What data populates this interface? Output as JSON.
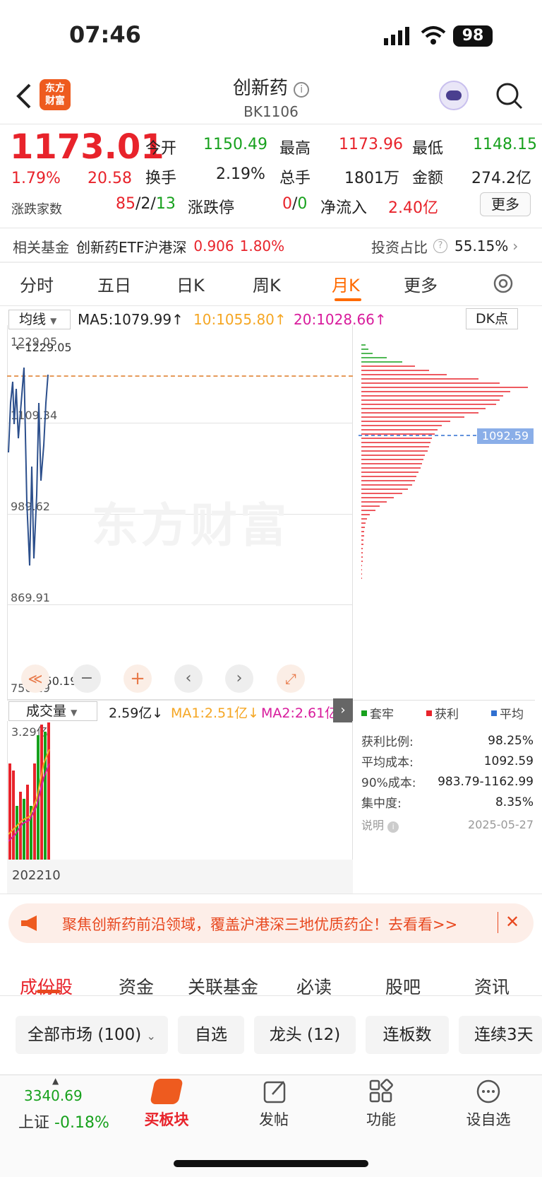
{
  "status": {
    "time": "07:46",
    "battery": "98"
  },
  "header": {
    "title": "创新药",
    "code": "BK1106",
    "logo": "东方财富"
  },
  "quote": {
    "price": "1173.01",
    "change_pct": "1.79%",
    "change": "20.58",
    "open_label": "今开",
    "open": "1150.49",
    "high_label": "最高",
    "high": "1173.96",
    "low_label": "最低",
    "low": "1148.15",
    "turnover_label": "换手",
    "turnover": "2.19%",
    "volume_label": "总手",
    "volume": "1801万",
    "amount_label": "金额",
    "amount": "274.2亿",
    "breadth_label": "涨跌家数",
    "up": "85",
    "flat": "2",
    "down": "13",
    "limit_label": "涨跌停",
    "limit_up": "0",
    "limit_down": "0",
    "inflow_label": "净流入",
    "inflow": "2.40亿",
    "more": "更多"
  },
  "fund": {
    "label": "相关基金",
    "name": "创新药ETF沪港深",
    "price": "0.906",
    "pct": "1.80%",
    "share_label": "投资占比",
    "share": "55.15%"
  },
  "ktabs": [
    "分时",
    "五日",
    "日K",
    "周K",
    "月K",
    "更多"
  ],
  "ma": {
    "label": "均线",
    "ma5": "MA5:1079.99↑",
    "ma10": "10:1055.80↑",
    "ma20": "20:1028.66↑",
    "dk": "DK点"
  },
  "y_ticks": [
    "1229.05",
    "1109.34",
    "989.62",
    "869.91",
    "750.19"
  ],
  "marks": {
    "high": "←1229.05",
    "low": "←750.19"
  },
  "watermark": "东方财富",
  "chip_price": "1092.59",
  "vol": {
    "label": "成交量",
    "value": "2.59亿↓",
    "ma1": "MA1:2.51亿↓",
    "ma2": "MA2:2.61亿",
    "max": "3.29亿",
    "date": "202210"
  },
  "chip_legend": [
    "套牢",
    "获利",
    "平均"
  ],
  "chip_stats": [
    {
      "k": "获利比例:",
      "v": "98.25%"
    },
    {
      "k": "平均成本:",
      "v": "1092.59"
    },
    {
      "k": "90%成本:",
      "v": "983.79-1162.99"
    },
    {
      "k": "集中度:",
      "v": "8.35%"
    }
  ],
  "chip_note": "说明",
  "chip_date": "2025-05-27",
  "banner": "聚焦创新药前沿领域，覆盖沪港深三地优质药企！去看看>>",
  "subtabs": [
    "成份股",
    "资金",
    "关联基金",
    "必读",
    "股吧",
    "资讯"
  ],
  "filters": [
    "全部市场 (100)",
    "自选",
    "龙头 (12)",
    "连板数",
    "连续3天"
  ],
  "index": {
    "value": "3340.69",
    "name": "上证",
    "pct": "-0.18%"
  },
  "nav": [
    "买板块",
    "发帖",
    "功能",
    "设自选"
  ],
  "colors": {
    "up": "#e8232b",
    "down": "#17a11d",
    "accent": "#ff6a00"
  }
}
